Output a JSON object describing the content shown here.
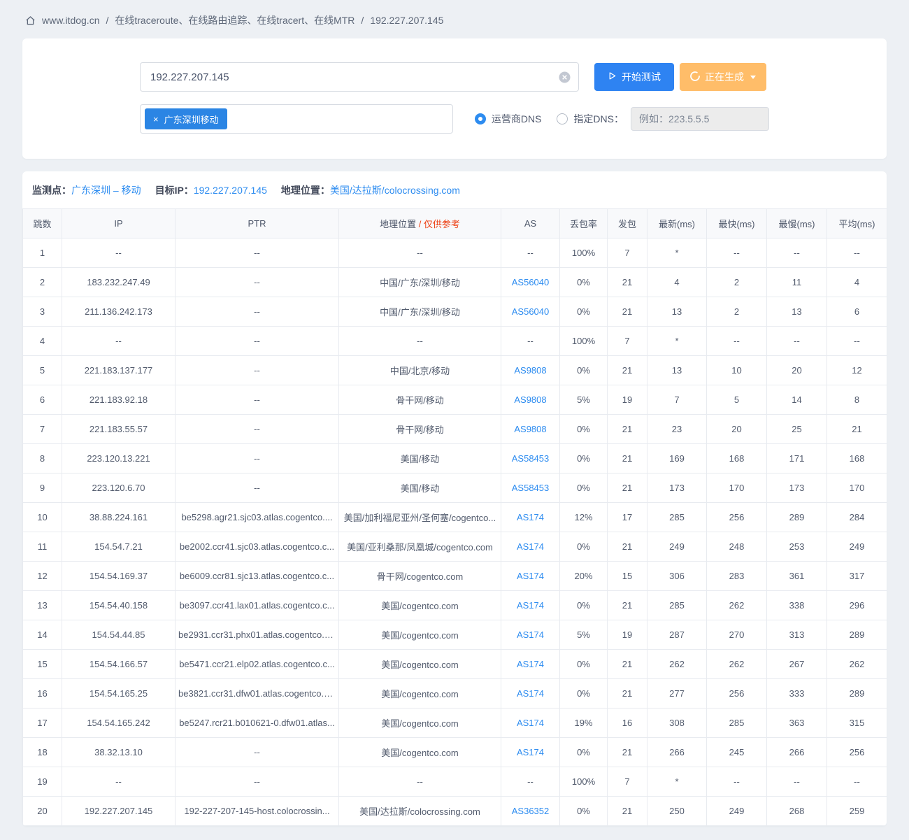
{
  "breadcrumb": {
    "site": "www.itdog.cn",
    "separator": "/",
    "path": "在线traceroute、在线路由追踪、在线tracert、在线MTR",
    "target": "192.227.207.145"
  },
  "form": {
    "target_input": "192.227.207.145",
    "start_button": "开始测试",
    "generating_button": "正在生成",
    "node_tag": "广东深圳移动",
    "tag_close": "×",
    "radio_isp_dns": "运营商DNS",
    "radio_custom_dns": "指定DNS：",
    "dns_placeholder": "例如：223.5.5.5"
  },
  "result": {
    "node_label": "监测点：",
    "node_value": "广东深圳 – 移动",
    "ip_label": "目标IP：",
    "ip_value": "192.227.207.145",
    "geo_label": "地理位置：",
    "geo_value": "美国/达拉斯/colocrossing.com"
  },
  "table": {
    "headers": [
      "跳数",
      "IP",
      "PTR",
      "地理位置",
      "AS",
      "丢包率",
      "发包",
      "最新(ms)",
      "最快(ms)",
      "最慢(ms)",
      "平均(ms)"
    ],
    "geo_note": " / 仅供参考",
    "rows": [
      {
        "hop": "1",
        "ip": "--",
        "ptr": "--",
        "geo": "--",
        "as": "--",
        "loss": "100%",
        "sent": "7",
        "latest": "*",
        "fastest": "--",
        "slowest": "--",
        "avg": "--"
      },
      {
        "hop": "2",
        "ip": "183.232.247.49",
        "ptr": "--",
        "geo": "中国/广东/深圳/移动",
        "as": "AS56040",
        "loss": "0%",
        "sent": "21",
        "latest": "4",
        "fastest": "2",
        "slowest": "11",
        "avg": "4"
      },
      {
        "hop": "3",
        "ip": "211.136.242.173",
        "ptr": "--",
        "geo": "中国/广东/深圳/移动",
        "as": "AS56040",
        "loss": "0%",
        "sent": "21",
        "latest": "13",
        "fastest": "2",
        "slowest": "13",
        "avg": "6"
      },
      {
        "hop": "4",
        "ip": "--",
        "ptr": "--",
        "geo": "--",
        "as": "--",
        "loss": "100%",
        "sent": "7",
        "latest": "*",
        "fastest": "--",
        "slowest": "--",
        "avg": "--"
      },
      {
        "hop": "5",
        "ip": "221.183.137.177",
        "ptr": "--",
        "geo": "中国/北京/移动",
        "as": "AS9808",
        "loss": "0%",
        "sent": "21",
        "latest": "13",
        "fastest": "10",
        "slowest": "20",
        "avg": "12"
      },
      {
        "hop": "6",
        "ip": "221.183.92.18",
        "ptr": "--",
        "geo": "骨干网/移动",
        "as": "AS9808",
        "loss": "5%",
        "sent": "19",
        "latest": "7",
        "fastest": "5",
        "slowest": "14",
        "avg": "8"
      },
      {
        "hop": "7",
        "ip": "221.183.55.57",
        "ptr": "--",
        "geo": "骨干网/移动",
        "as": "AS9808",
        "loss": "0%",
        "sent": "21",
        "latest": "23",
        "fastest": "20",
        "slowest": "25",
        "avg": "21"
      },
      {
        "hop": "8",
        "ip": "223.120.13.221",
        "ptr": "--",
        "geo": "美国/移动",
        "as": "AS58453",
        "loss": "0%",
        "sent": "21",
        "latest": "169",
        "fastest": "168",
        "slowest": "171",
        "avg": "168"
      },
      {
        "hop": "9",
        "ip": "223.120.6.70",
        "ptr": "--",
        "geo": "美国/移动",
        "as": "AS58453",
        "loss": "0%",
        "sent": "21",
        "latest": "173",
        "fastest": "170",
        "slowest": "173",
        "avg": "170"
      },
      {
        "hop": "10",
        "ip": "38.88.224.161",
        "ptr": "be5298.agr21.sjc03.atlas.cogentco....",
        "geo": "美国/加利福尼亚州/圣何塞/cogentco...",
        "as": "AS174",
        "loss": "12%",
        "sent": "17",
        "latest": "285",
        "fastest": "256",
        "slowest": "289",
        "avg": "284"
      },
      {
        "hop": "11",
        "ip": "154.54.7.21",
        "ptr": "be2002.ccr41.sjc03.atlas.cogentco.c...",
        "geo": "美国/亚利桑那/凤凰城/cogentco.com",
        "as": "AS174",
        "loss": "0%",
        "sent": "21",
        "latest": "249",
        "fastest": "248",
        "slowest": "253",
        "avg": "249"
      },
      {
        "hop": "12",
        "ip": "154.54.169.37",
        "ptr": "be6009.ccr81.sjc13.atlas.cogentco.c...",
        "geo": "骨干网/cogentco.com",
        "as": "AS174",
        "loss": "20%",
        "sent": "15",
        "latest": "306",
        "fastest": "283",
        "slowest": "361",
        "avg": "317"
      },
      {
        "hop": "13",
        "ip": "154.54.40.158",
        "ptr": "be3097.ccr41.lax01.atlas.cogentco.c...",
        "geo": "美国/cogentco.com",
        "as": "AS174",
        "loss": "0%",
        "sent": "21",
        "latest": "285",
        "fastest": "262",
        "slowest": "338",
        "avg": "296"
      },
      {
        "hop": "14",
        "ip": "154.54.44.85",
        "ptr": "be2931.ccr31.phx01.atlas.cogentco.c...",
        "geo": "美国/cogentco.com",
        "as": "AS174",
        "loss": "5%",
        "sent": "19",
        "latest": "287",
        "fastest": "270",
        "slowest": "313",
        "avg": "289"
      },
      {
        "hop": "15",
        "ip": "154.54.166.57",
        "ptr": "be5471.ccr21.elp02.atlas.cogentco.c...",
        "geo": "美国/cogentco.com",
        "as": "AS174",
        "loss": "0%",
        "sent": "21",
        "latest": "262",
        "fastest": "262",
        "slowest": "267",
        "avg": "262"
      },
      {
        "hop": "16",
        "ip": "154.54.165.25",
        "ptr": "be3821.ccr31.dfw01.atlas.cogentco.c...",
        "geo": "美国/cogentco.com",
        "as": "AS174",
        "loss": "0%",
        "sent": "21",
        "latest": "277",
        "fastest": "256",
        "slowest": "333",
        "avg": "289"
      },
      {
        "hop": "17",
        "ip": "154.54.165.242",
        "ptr": "be5247.rcr21.b010621-0.dfw01.atlas...",
        "geo": "美国/cogentco.com",
        "as": "AS174",
        "loss": "19%",
        "sent": "16",
        "latest": "308",
        "fastest": "285",
        "slowest": "363",
        "avg": "315"
      },
      {
        "hop": "18",
        "ip": "38.32.13.10",
        "ptr": "--",
        "geo": "美国/cogentco.com",
        "as": "AS174",
        "loss": "0%",
        "sent": "21",
        "latest": "266",
        "fastest": "245",
        "slowest": "266",
        "avg": "256"
      },
      {
        "hop": "19",
        "ip": "--",
        "ptr": "--",
        "geo": "--",
        "as": "--",
        "loss": "100%",
        "sent": "7",
        "latest": "*",
        "fastest": "--",
        "slowest": "--",
        "avg": "--"
      },
      {
        "hop": "20",
        "ip": "192.227.207.145",
        "ptr": "192-227-207-145-host.colocrossin...",
        "geo": "美国/达拉斯/colocrossing.com",
        "as": "AS36352",
        "loss": "0%",
        "sent": "21",
        "latest": "250",
        "fastest": "249",
        "slowest": "268",
        "avg": "259"
      }
    ]
  },
  "colors": {
    "accent_blue": "#2d8cf0",
    "button_blue": "#2e83f2",
    "button_orange": "#ffbd69",
    "tag_blue": "#2b85e4",
    "note_red": "#ed4014",
    "page_bg": "#edf0f4"
  }
}
